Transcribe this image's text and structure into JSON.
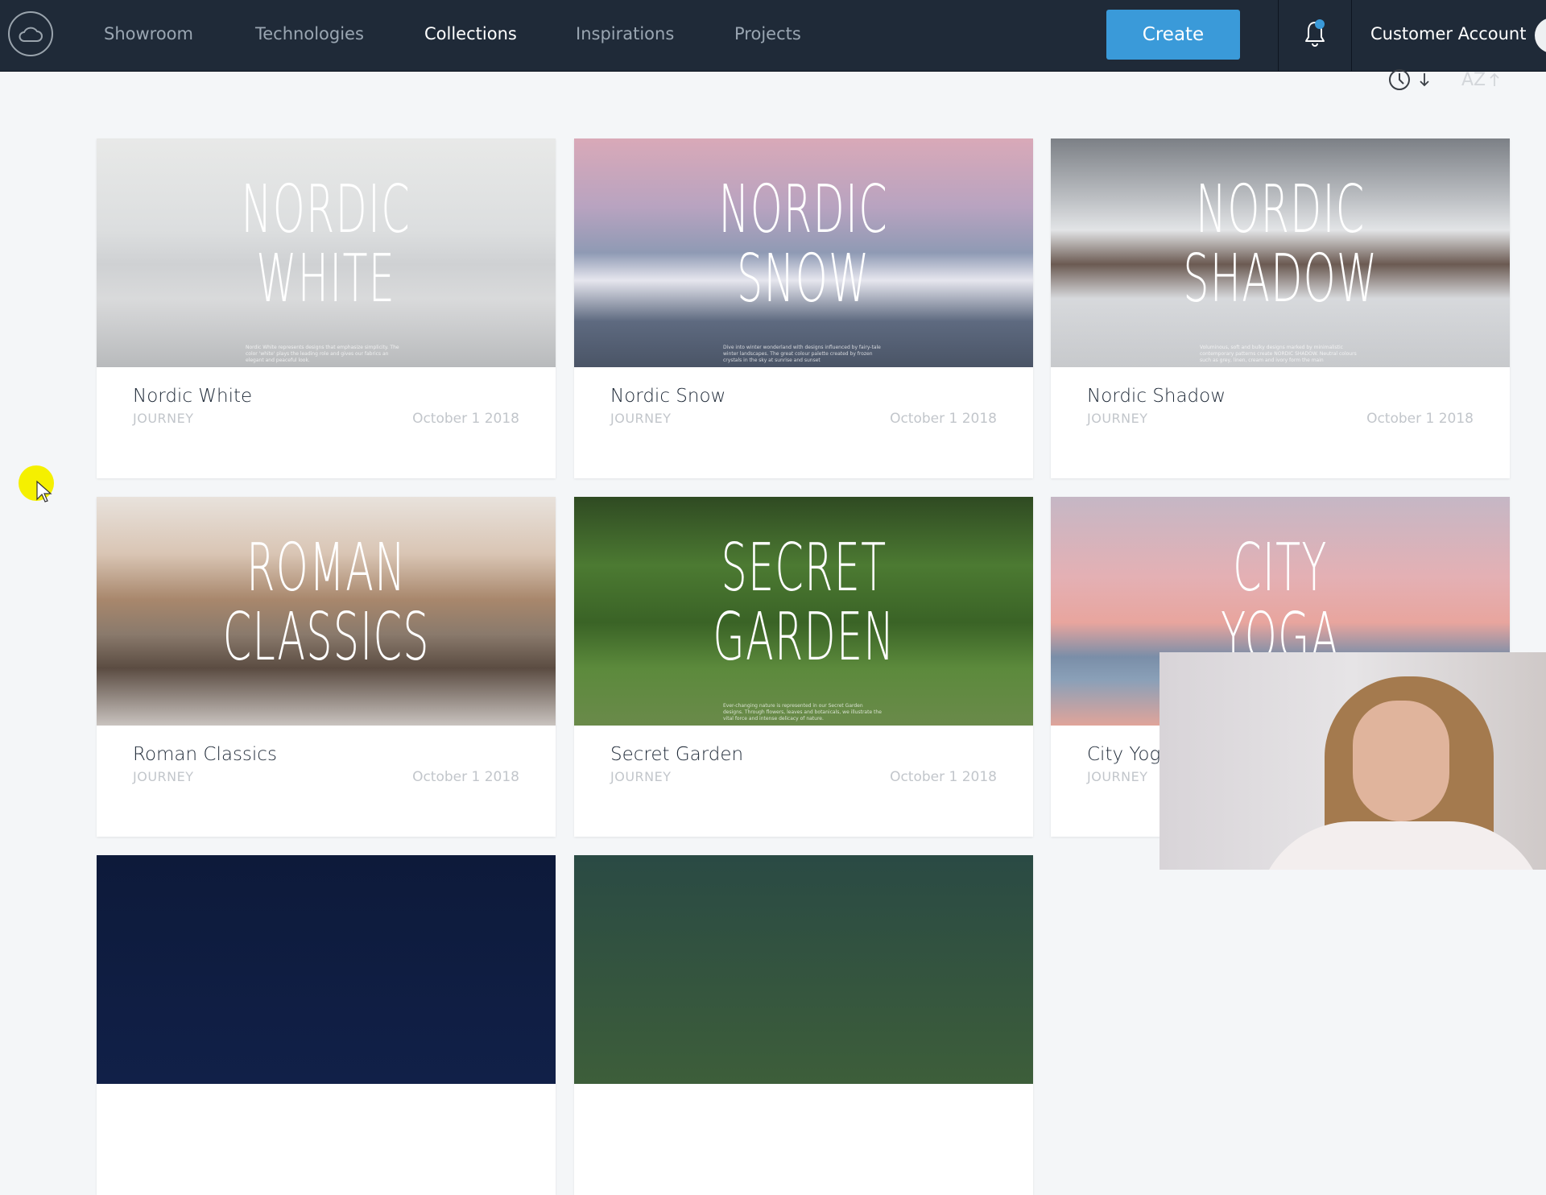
{
  "navbar": {
    "logo_icon": "cloud-icon",
    "items": [
      {
        "label": "Showroom",
        "active": false
      },
      {
        "label": "Technologies",
        "active": false
      },
      {
        "label": "Collections",
        "active": true
      },
      {
        "label": "Inspirations",
        "active": false
      },
      {
        "label": "Projects",
        "active": false
      }
    ],
    "create_label": "Create",
    "notification_icon": "bell-icon",
    "has_notification": true,
    "account_label": "Customer Account",
    "accent_color": "#3a9ad9",
    "background_color": "#1f2a38"
  },
  "sort": {
    "time_icon": "clock-icon",
    "time_direction_icon": "arrow-down-icon",
    "alpha_label": "AZ",
    "alpha_direction_icon": "arrow-up-icon"
  },
  "collections": [
    {
      "name": "Nordic White",
      "overlay_title": "NORDIC\nWHITE",
      "overlay_text": "Nordic White represents designs that emphasize simplicity. The color 'white' plays the leading role and gives our fabrics an elegant and peaceful look.",
      "type": "JOURNEY",
      "date": "October 1 2018"
    },
    {
      "name": "Nordic Snow",
      "overlay_title": "NORDIC\nSNOW",
      "overlay_text": "Dive into winter wonderland with designs influenced by fairy-tale winter landscapes. The great colour palette created by frozen crystals in the sky at sunrise and sunset",
      "type": "JOURNEY",
      "date": "October 1 2018"
    },
    {
      "name": "Nordic Shadow",
      "overlay_title": "NORDIC\nSHADOW",
      "overlay_text": "Voluminous, soft and bulky designs marked by minimalistic contemporary patterns create NORDIC SHADOW. Neutral colours such as grey, linen, cream and ivory form the main",
      "type": "JOURNEY",
      "date": "October 1 2018"
    },
    {
      "name": "Roman Classics",
      "overlay_title": "ROMAN\nCLASSICS",
      "overlay_text": "",
      "type": "JOURNEY",
      "date": "October 1 2018"
    },
    {
      "name": "Secret Garden",
      "overlay_title": "SECRET\nGARDEN",
      "overlay_text": "Ever-changing nature is represented in our Secret Garden designs. Through flowers, leaves and botanicals, we illustrate the vital force and intense delicacy of nature.",
      "type": "JOURNEY",
      "date": "October 1 2018"
    },
    {
      "name": "City Yog",
      "overlay_title": "CITY\nYOGA",
      "overlay_text": "",
      "type": "JOURNEY",
      "date": ""
    }
  ]
}
